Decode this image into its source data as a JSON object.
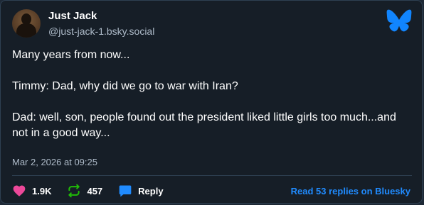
{
  "post": {
    "author": {
      "display_name": "Just Jack",
      "handle": "@just-jack-1.bsky.social"
    },
    "text_lines": [
      "Many years from now...",
      "Timmy: Dad, why did we go to war with Iran?",
      "Dad: well, son, people found out the president liked little girls too much...and not in a good way..."
    ],
    "timestamp": "Mar 2, 2026 at 09:25"
  },
  "actions": {
    "likes": "1.9K",
    "reposts": "457",
    "reply_label": "Reply",
    "read_replies_label": "Read 53 replies on Bluesky"
  },
  "icons": {
    "brand": "bluesky-butterfly-icon",
    "like": "heart-icon",
    "repost": "repost-icon",
    "reply": "speech-bubble-icon"
  },
  "colors": {
    "background": "#161e27",
    "border": "#2e4052",
    "text": "#ffffff",
    "muted": "#aebbc9",
    "brand_blue": "#208bfe",
    "like_pink": "#ec4899",
    "repost_green": "#20bc07"
  }
}
